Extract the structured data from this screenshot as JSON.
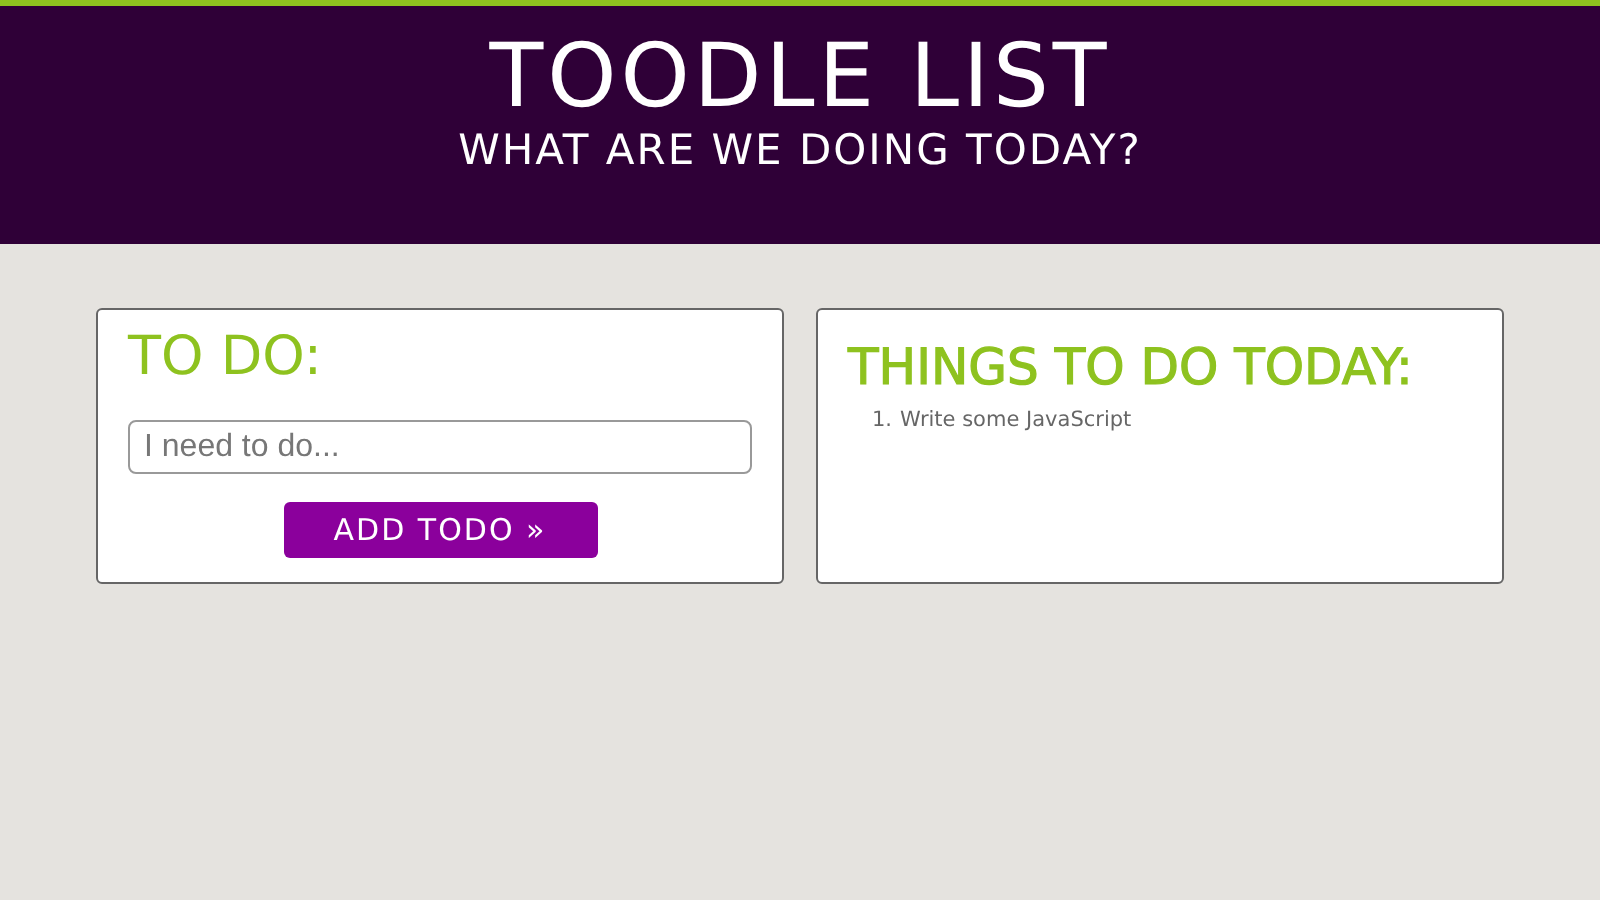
{
  "header": {
    "title": "TOODLE LIST",
    "subtitle": "WHAT ARE WE DOING TODAY?"
  },
  "todo_panel": {
    "heading": "TO DO:",
    "input": {
      "placeholder": "I need to do..."
    },
    "button": "ADD TODO »"
  },
  "list_panel": {
    "heading": "THINGS TO DO TODAY:",
    "items": [
      {
        "number": "1.",
        "text": "Write some JavaScript"
      }
    ]
  }
}
